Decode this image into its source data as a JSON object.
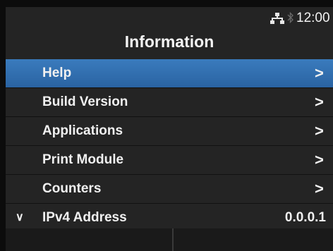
{
  "status": {
    "time": "12:00",
    "network_icon": "network-icon",
    "bluetooth_icon": "bluetooth-icon"
  },
  "title": "Information",
  "menu": {
    "items": [
      {
        "label": "Help",
        "selected": true,
        "icon": "chevron-right-icon"
      },
      {
        "label": "Build Version",
        "icon": "chevron-right-icon"
      },
      {
        "label": "Applications",
        "icon": "chevron-right-icon"
      },
      {
        "label": "Print Module",
        "icon": "chevron-right-icon"
      },
      {
        "label": "Counters",
        "icon": "chevron-right-icon"
      }
    ],
    "ipv4": {
      "label": "IPv4 Address",
      "value": "0.0.0.1",
      "icon": "chevron-down-icon"
    }
  },
  "colors": {
    "selected": "#3a7bbd",
    "background": "#242424"
  }
}
